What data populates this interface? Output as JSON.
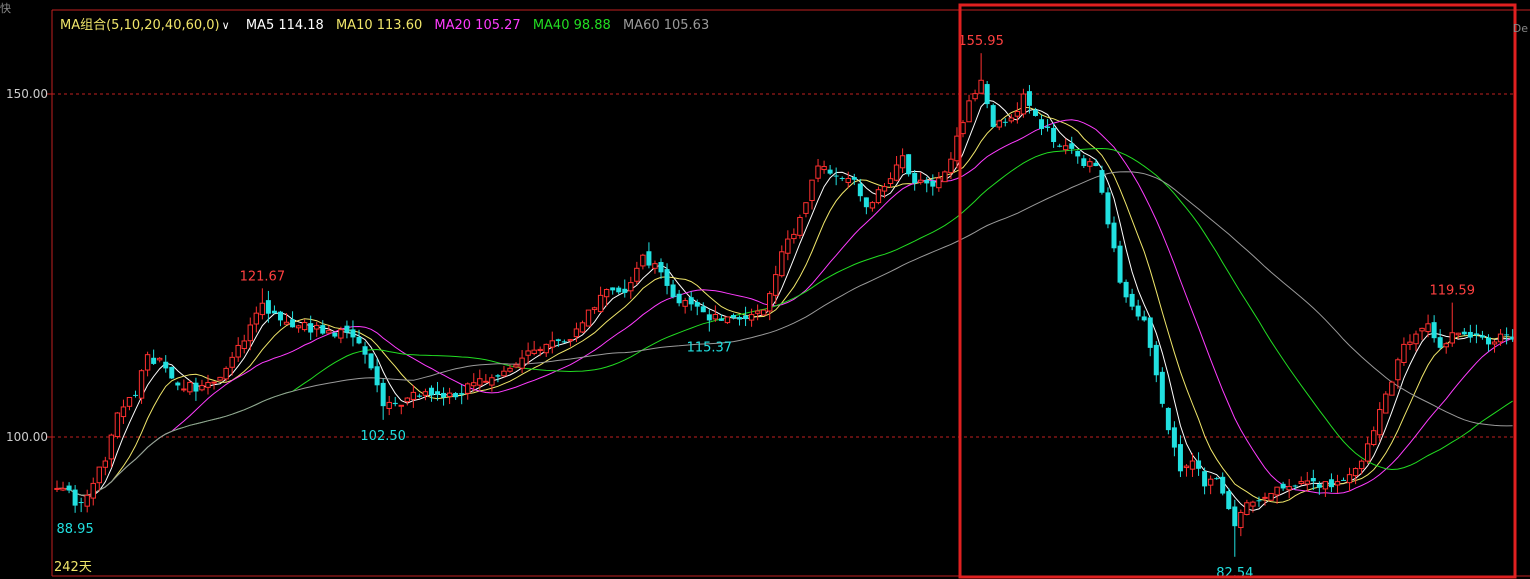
{
  "header": {
    "ma_selector": "MA组合(5,10,20,40,60,0)",
    "dropdown_glyph": "∨",
    "corner_glyph": "快",
    "right_edge_text": "De"
  },
  "legend": [
    {
      "label": "MA5 114.18",
      "color": "#ffffff"
    },
    {
      "label": "MA10 113.60",
      "color": "#f0e66a"
    },
    {
      "label": "MA20 105.27",
      "color": "#ff3cff"
    },
    {
      "label": "MA40 98.88",
      "color": "#22dd22"
    },
    {
      "label": "MA60 105.63",
      "color": "#9a9a9a"
    }
  ],
  "colors": {
    "up": "#ff3030",
    "down": "#21e0e0",
    "axis": "#c02020",
    "label_high": "#ff4040",
    "label_low": "#21e0e0",
    "axis_text": "#cccccc",
    "legend_main": "#f0e66a",
    "days_text": "#f0e66a",
    "highlight_box": "#e02020"
  },
  "footer": {
    "days": "242天"
  },
  "chart_data": {
    "type": "candlestick",
    "y_ticks": [
      "150.00",
      "100.00"
    ],
    "grid_lines": [
      150,
      100
    ],
    "ylim": [
      80.4,
      158.5
    ],
    "n": 242,
    "annotations": [
      {
        "text": "88.95",
        "index": 3,
        "value": 88.95,
        "kind": "low"
      },
      {
        "text": "121.67",
        "index": 34,
        "value": 121.67,
        "kind": "high"
      },
      {
        "text": "102.50",
        "index": 54,
        "value": 102.5,
        "kind": "low"
      },
      {
        "text": "115.37",
        "index": 108,
        "value": 115.37,
        "kind": "low"
      },
      {
        "text": "155.95",
        "index": 153,
        "value": 155.95,
        "kind": "high"
      },
      {
        "text": "82.54",
        "index": 195,
        "value": 82.54,
        "kind": "low"
      },
      {
        "text": "119.59",
        "index": 231,
        "value": 119.59,
        "kind": "high"
      }
    ],
    "highlight_range": [
      150,
      241
    ],
    "close_anchors": [
      [
        0,
        92.5
      ],
      [
        2,
        92.2
      ],
      [
        3,
        90.0
      ],
      [
        5,
        91.5
      ],
      [
        8,
        96.5
      ],
      [
        10,
        103.5
      ],
      [
        13,
        106
      ],
      [
        15,
        112
      ],
      [
        18,
        110
      ],
      [
        21,
        107
      ],
      [
        24,
        107.5
      ],
      [
        28,
        110
      ],
      [
        31,
        114
      ],
      [
        34,
        119.5
      ],
      [
        37,
        117
      ],
      [
        40,
        116.2
      ],
      [
        45,
        115.5
      ],
      [
        48,
        115.2
      ],
      [
        51,
        112
      ],
      [
        54,
        104.5
      ],
      [
        56,
        104.8
      ],
      [
        59,
        106.5
      ],
      [
        63,
        106.2
      ],
      [
        66,
        105.8
      ],
      [
        70,
        108.5
      ],
      [
        73,
        108.8
      ],
      [
        77,
        111.5
      ],
      [
        81,
        113.5
      ],
      [
        85,
        114.2
      ],
      [
        88,
        118.5
      ],
      [
        91,
        121.5
      ],
      [
        94,
        121
      ],
      [
        97,
        126.5
      ],
      [
        100,
        124
      ],
      [
        103,
        119.5
      ],
      [
        106,
        119
      ],
      [
        108,
        117
      ],
      [
        111,
        117.5
      ],
      [
        114,
        117.2
      ],
      [
        117,
        118.5
      ],
      [
        120,
        127
      ],
      [
        123,
        132
      ],
      [
        126,
        139.5
      ],
      [
        129,
        138
      ],
      [
        132,
        137.5
      ],
      [
        134,
        133.5
      ],
      [
        137,
        136.5
      ],
      [
        140,
        141
      ],
      [
        142,
        137
      ],
      [
        145,
        136.5
      ],
      [
        148,
        140.5
      ],
      [
        151,
        149
      ],
      [
        153,
        152
      ],
      [
        155,
        145.2
      ],
      [
        158,
        146.5
      ],
      [
        160,
        150
      ],
      [
        162,
        146.8
      ],
      [
        165,
        143
      ],
      [
        168,
        142
      ],
      [
        170,
        139.5
      ],
      [
        172,
        139.5
      ],
      [
        174,
        131
      ],
      [
        176,
        122.5
      ],
      [
        178,
        119
      ],
      [
        180,
        117
      ],
      [
        182,
        109
      ],
      [
        184,
        101
      ],
      [
        186,
        95
      ],
      [
        188,
        96.5
      ],
      [
        190,
        92.8
      ],
      [
        192,
        94
      ],
      [
        194,
        89.5
      ],
      [
        195,
        87
      ],
      [
        196,
        89
      ],
      [
        198,
        90.5
      ],
      [
        200,
        91.2
      ],
      [
        203,
        92.5
      ],
      [
        206,
        93.5
      ],
      [
        209,
        92.6
      ],
      [
        212,
        93.5
      ],
      [
        215,
        95.4
      ],
      [
        217,
        99
      ],
      [
        219,
        104
      ],
      [
        221,
        108
      ],
      [
        223,
        113.5
      ],
      [
        225,
        115
      ],
      [
        227,
        116.5
      ],
      [
        229,
        113
      ],
      [
        231,
        115.2
      ],
      [
        234,
        114.5
      ],
      [
        237,
        113.5
      ],
      [
        239,
        115
      ],
      [
        241,
        114.2
      ]
    ],
    "ma_series": [
      {
        "name": "MA5",
        "period": 5,
        "color": "#ffffff"
      },
      {
        "name": "MA10",
        "period": 10,
        "color": "#f0e66a"
      },
      {
        "name": "MA20",
        "period": 20,
        "color": "#ff3cff"
      },
      {
        "name": "MA40",
        "period": 40,
        "color": "#22dd22"
      },
      {
        "name": "MA60",
        "period": 60,
        "color": "#9a9a9a"
      }
    ]
  }
}
